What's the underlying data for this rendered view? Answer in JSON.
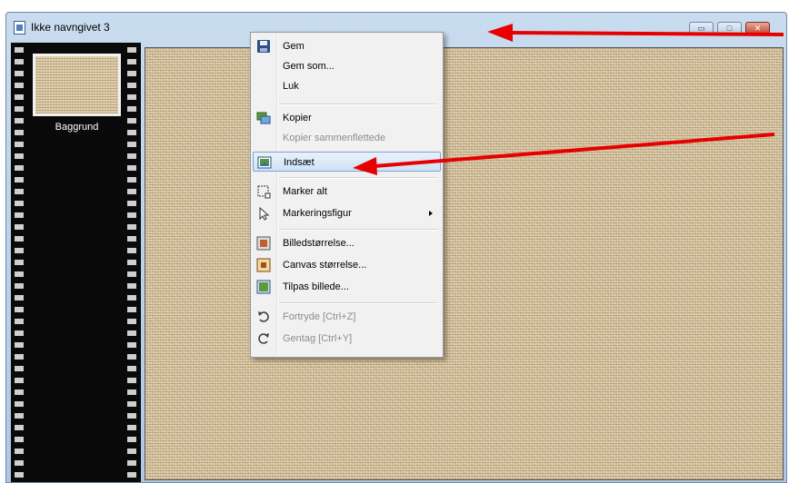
{
  "window": {
    "title": "Ikke navngivet 3",
    "caption_buttons": {
      "minimize": "▭",
      "maximize": "□",
      "close": "✕"
    }
  },
  "layers": {
    "items": [
      {
        "label": "Baggrund"
      }
    ]
  },
  "context_menu": {
    "items": [
      {
        "label": "Gem",
        "icon": "floppy-disk-icon",
        "enabled": true
      },
      {
        "label": "Gem som...",
        "enabled": true
      },
      {
        "label": "Luk",
        "enabled": true
      },
      {
        "label": "Kopier",
        "icon": "copy-image-icon",
        "enabled": true
      },
      {
        "label": "Kopier sammenflettede",
        "enabled": false
      },
      {
        "label": "Indsæt",
        "icon": "paste-image-icon",
        "enabled": true,
        "highlighted": true
      },
      {
        "label": "Marker alt",
        "icon": "select-all-icon",
        "enabled": true
      },
      {
        "label": "Markeringsfigur",
        "icon": "selection-shape-icon",
        "enabled": true,
        "submenu": true
      },
      {
        "label": "Billedstørrelse...",
        "icon": "image-size-icon",
        "enabled": true
      },
      {
        "label": "Canvas størrelse...",
        "icon": "canvas-size-icon",
        "enabled": true
      },
      {
        "label": "Tilpas billede...",
        "icon": "fit-image-icon",
        "enabled": true
      },
      {
        "label": "Fortryde [Ctrl+Z]",
        "icon": "undo-icon",
        "enabled": false
      },
      {
        "label": "Gentag [Ctrl+Y]",
        "icon": "redo-icon",
        "enabled": false
      }
    ]
  },
  "colors": {
    "annotation_arrow": "#e60000",
    "menu_highlight": "#cfe2f7",
    "canvas_texture": "#d6c4a1"
  }
}
